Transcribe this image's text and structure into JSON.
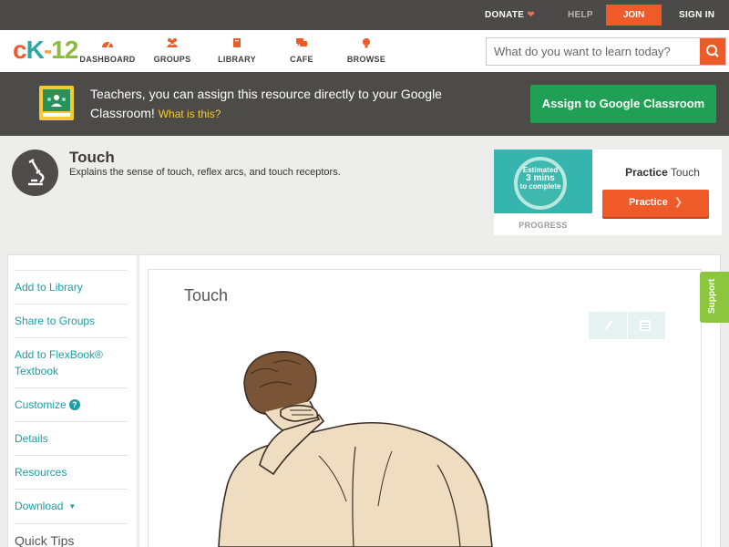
{
  "topbar": {
    "donate": "DONATE",
    "help": "HELP",
    "join": "JOIN",
    "signin": "SIGN IN"
  },
  "nav": {
    "logo": {
      "c": "c",
      "k": "K",
      "dash": "-",
      "num": "12"
    },
    "items": [
      {
        "label": "DASHBOARD",
        "icon": "dashboard-icon"
      },
      {
        "label": "GROUPS",
        "icon": "groups-icon"
      },
      {
        "label": "LIBRARY",
        "icon": "library-icon"
      },
      {
        "label": "CAFE",
        "icon": "cafe-icon"
      },
      {
        "label": "BROWSE",
        "icon": "browse-icon"
      }
    ],
    "search_placeholder": "What do you want to learn today?"
  },
  "banner": {
    "text": "Teachers, you can assign this resource directly to your Google Classroom!",
    "what_link": "What is this?",
    "assign_button": "Assign to Google Classroom"
  },
  "concept": {
    "title": "Touch",
    "description": "Explains the sense of touch, reflex arcs, and touch receptors."
  },
  "practice": {
    "estimated": "Estimated",
    "mins": "3 mins",
    "to_complete": "to complete",
    "progress_label": "PROGRESS",
    "title_bold": "Practice",
    "title_rest": "Touch",
    "button": "Practice"
  },
  "sidebar": {
    "items": [
      "Add to Library",
      "Share to Groups",
      "Add to FlexBook® Textbook",
      "Customize",
      "Details",
      "Resources",
      "Download",
      "Quick Tips"
    ],
    "help_glyph": "?"
  },
  "content": {
    "title": "Touch"
  },
  "support": "Support",
  "colors": {
    "accent_orange": "#f05a28",
    "teal": "#1c9ea4",
    "green": "#20a055",
    "support_green": "#8cc63f"
  }
}
